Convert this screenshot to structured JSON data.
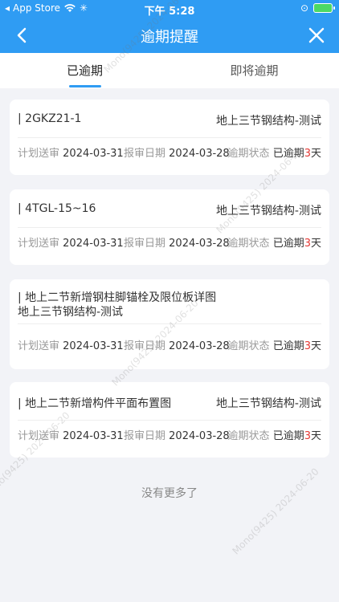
{
  "status_bar": {
    "carrier": "App Store",
    "time": "下午 5:28"
  },
  "nav": {
    "title": "逾期提醒"
  },
  "tabs": [
    {
      "label": "已逾期",
      "active": true
    },
    {
      "label": "即将逾期",
      "active": false
    }
  ],
  "labels": {
    "planned_submit": "计划送审",
    "report_date": "报审日期",
    "overdue_status": "逾期状态"
  },
  "cards": [
    {
      "code": "| 2GKZ21-1",
      "project": "地上三节钢结构-测试",
      "planned": "2024-03-31",
      "reported": "2024-03-28",
      "status_prefix": "已逾期",
      "status_days": "3",
      "status_suffix": "天"
    },
    {
      "code": "| 4TGL-15~16",
      "project": "地上三节钢结构-测试",
      "planned": "2024-03-31",
      "reported": "2024-03-28",
      "status_prefix": "已逾期",
      "status_days": "3",
      "status_suffix": "天"
    },
    {
      "code": "| 地上二节新增钢柱脚锚栓及限位板详图",
      "project": "地上三节钢结构-测试",
      "planned": "2024-03-31",
      "reported": "2024-03-28",
      "status_prefix": "已逾期",
      "status_days": "3",
      "status_suffix": "天"
    },
    {
      "code": "| 地上二节新增构件平面布置图",
      "project": "地上三节钢结构-测试",
      "planned": "2024-03-31",
      "reported": "2024-03-28",
      "status_prefix": "已逾期",
      "status_days": "3",
      "status_suffix": "天"
    }
  ],
  "footer": {
    "text": "没有更多了"
  },
  "watermark": "Mono(9425) 2024-06-20",
  "colors": {
    "header_bg": "#2f9cf3",
    "accent": "#2f9cf3",
    "overdue_days": "#e53935",
    "battery": "#4cd964"
  }
}
